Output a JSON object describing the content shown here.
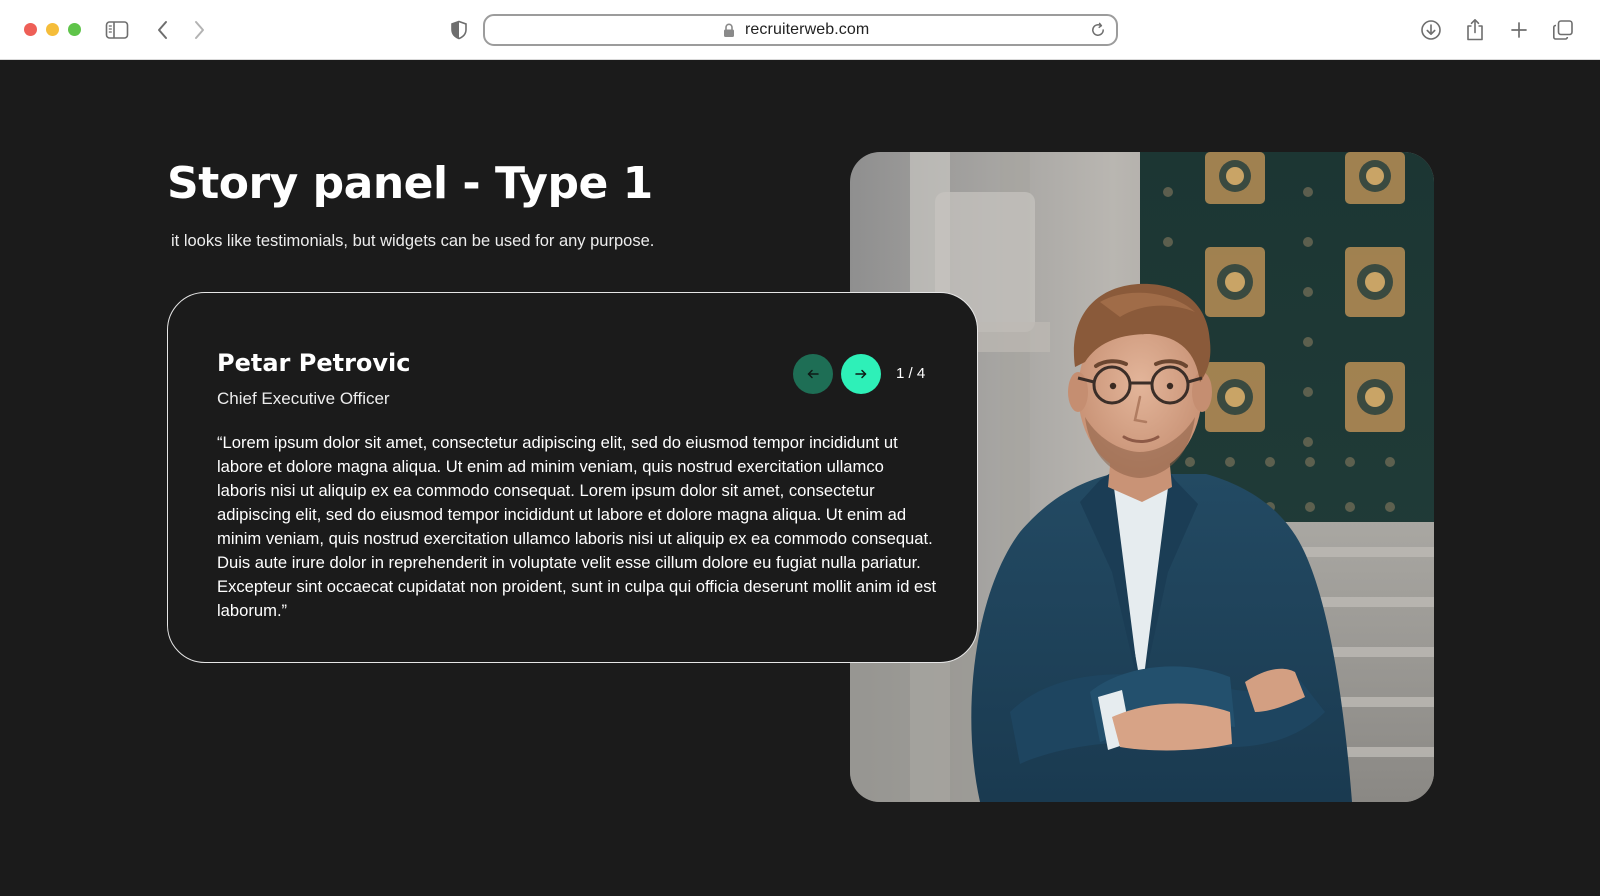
{
  "browser": {
    "url": "recruiterweb.com",
    "icons": [
      "sidebar-icon",
      "back-icon",
      "forward-icon",
      "shield-icon",
      "lock-icon",
      "reload-icon",
      "download-icon",
      "share-icon",
      "new-tab-icon",
      "tabs-icon"
    ]
  },
  "page": {
    "title": "Story panel - Type 1",
    "subtitle": "it looks like testimonials, but widgets can be used for any purpose."
  },
  "testimonial": {
    "name": "Petar Petrovic",
    "role": "Chief Executive Officer",
    "quote": "“Lorem ipsum dolor sit amet, consectetur adipiscing elit, sed do eiusmod tempor incididunt ut labore et dolore magna aliqua. Ut enim ad minim veniam, quis nostrud exercitation ullamco laboris nisi ut aliquip ex ea commodo consequat.  Lorem ipsum dolor sit amet, consectetur adipiscing elit, sed do eiusmod tempor incididunt ut labore et dolore magna aliqua. Ut enim ad minim veniam, quis nostrud exercitation ullamco laboris nisi ut aliquip ex ea commodo consequat. Duis aute irure dolor in reprehenderit in voluptate velit esse cillum dolore eu fugiat nulla pariatur. Excepteur sint occaecat cupidatat non proident, sunt in culpa qui officia deserunt mollit anim id est laborum.”",
    "pager": "1 / 4",
    "prev_icon": "arrow-left-icon",
    "next_icon": "arrow-right-icon"
  },
  "colors": {
    "page_background": "#1b1b1b",
    "prev_button": "#1e6e55",
    "next_button": "#2ef0b8",
    "card_border": "#e6e6e6"
  }
}
